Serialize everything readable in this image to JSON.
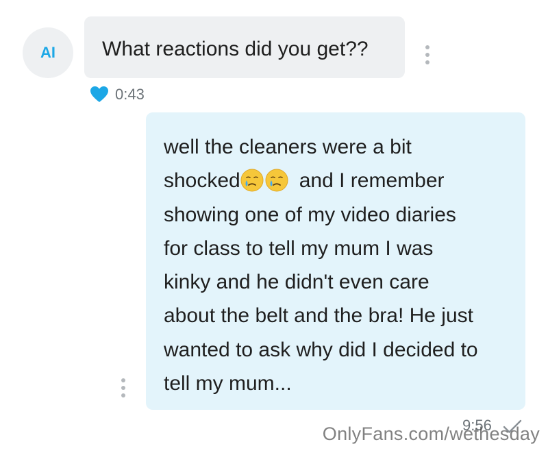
{
  "incoming": {
    "avatar_initials": "AI",
    "message": "What reactions did you get??",
    "time": "0:43",
    "reaction_icon": "heart-icon",
    "reaction_color": "#1ca7e6"
  },
  "outgoing": {
    "lines": {
      "l1": "well the cleaners were a bit",
      "l2_before": "shocked",
      "l2_after": "and I remember",
      "l3": "showing one of my video diaries",
      "l4": "for class to tell my mum I was",
      "l5": "kinky and he didn't even care",
      "l6": "about the belt and the bra! He just",
      "l7": "wanted to ask why did I decided to",
      "l8": "tell my mum..."
    },
    "emojis": [
      "crying-face-emoji",
      "crying-face-emoji"
    ],
    "time": "9:56",
    "status_icon": "checkmark-icon"
  },
  "watermark": "OnlyFans.com/wethesday",
  "colors": {
    "incoming_bubble": "#eef0f2",
    "outgoing_bubble": "#e3f4fb",
    "accent": "#1ca7e6"
  }
}
